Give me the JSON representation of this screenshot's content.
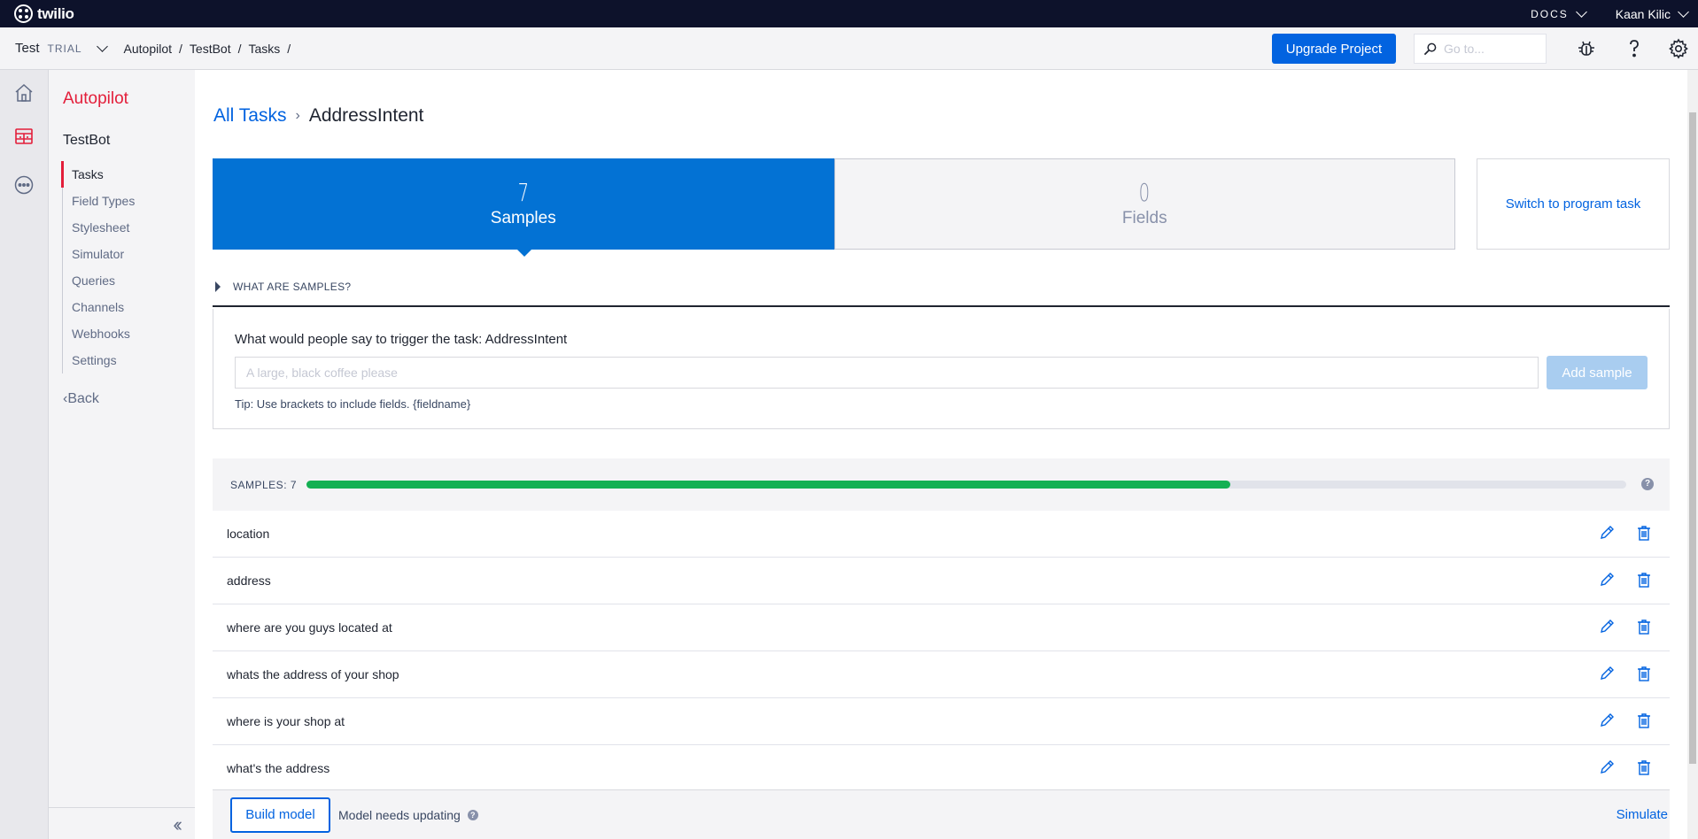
{
  "topbar": {
    "brand": "twilio",
    "docs_label": "DOCS",
    "user_name": "Kaan Kilic"
  },
  "subbar": {
    "project_name": "Test",
    "project_badge": "TRIAL",
    "breadcrumbs": [
      "Autopilot",
      "TestBot",
      "Tasks"
    ],
    "upgrade_label": "Upgrade Project",
    "goto_placeholder": "Go to..."
  },
  "sidebar": {
    "product": "Autopilot",
    "bot_name": "TestBot",
    "items": [
      {
        "label": "Tasks",
        "active": true
      },
      {
        "label": "Field Types"
      },
      {
        "label": "Stylesheet"
      },
      {
        "label": "Simulator"
      },
      {
        "label": "Queries"
      },
      {
        "label": "Channels"
      },
      {
        "label": "Webhooks"
      },
      {
        "label": "Settings"
      }
    ],
    "back_label": "Back"
  },
  "page": {
    "breadcrumb_root": "All Tasks",
    "task_name": "AddressIntent",
    "tabs": [
      {
        "count": "7",
        "label": "Samples",
        "active": true
      },
      {
        "count": "0",
        "label": "Fields"
      }
    ],
    "switch_label": "Switch to program task",
    "what_are_samples": "WHAT ARE SAMPLES?",
    "add_prompt": "What would people say to trigger the task: AddressIntent",
    "add_placeholder": "A large, black coffee please",
    "add_button": "Add sample",
    "tip": "Tip: Use brackets to include fields. {fieldname}",
    "samples_label": "SAMPLES: 7",
    "samples_progress": 0.7,
    "samples": [
      "location",
      "address",
      "where are you guys located at",
      "whats the address of your shop",
      "where is your shop at",
      "what's the address"
    ],
    "build_label": "Build model",
    "model_status": "Model needs updating",
    "simulate_label": "Simulate"
  },
  "colors": {
    "brand_red": "#e31e3a",
    "primary_blue": "#0263e0",
    "progress_green": "#14b053"
  }
}
